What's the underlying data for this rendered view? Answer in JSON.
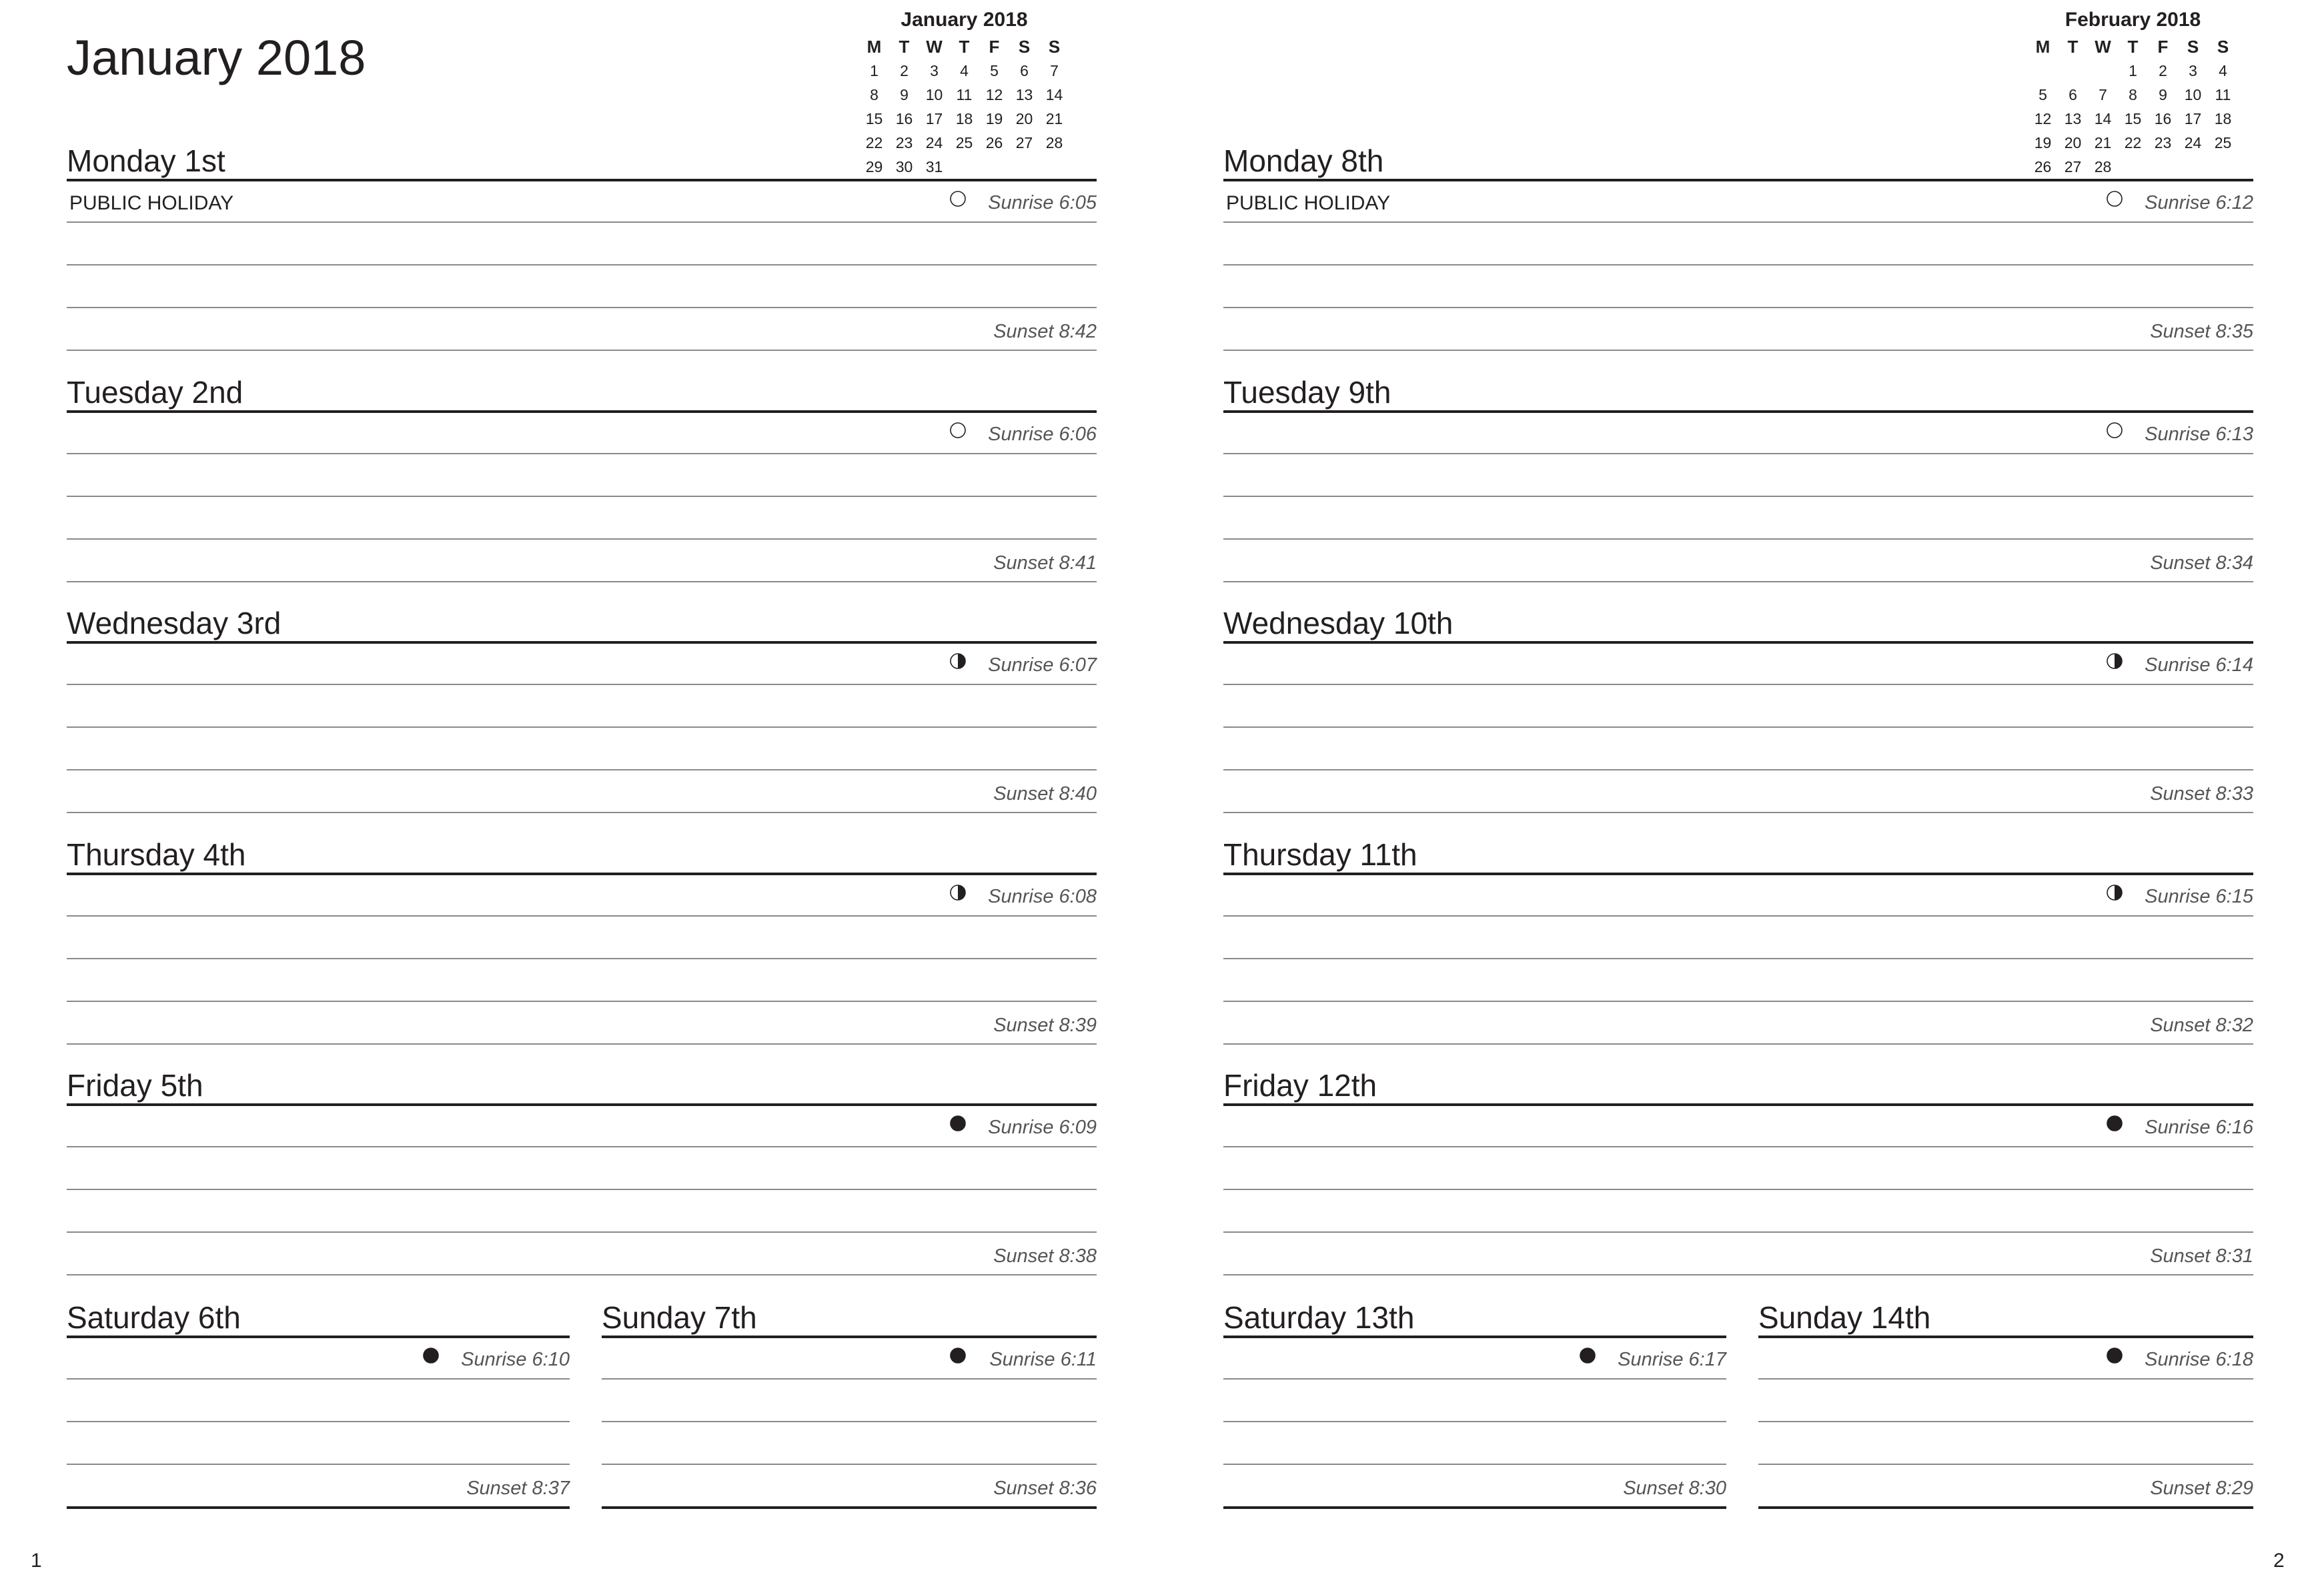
{
  "pages": [
    {
      "title": "January 2018",
      "page_number": "1",
      "mini_calendar": {
        "title": "January 2018",
        "headers": [
          "M",
          "T",
          "W",
          "T",
          "F",
          "S",
          "S"
        ],
        "cells": [
          "1",
          "2",
          "3",
          "4",
          "5",
          "6",
          "7",
          "8",
          "9",
          "10",
          "11",
          "12",
          "13",
          "14",
          "15",
          "16",
          "17",
          "18",
          "19",
          "20",
          "21",
          "22",
          "23",
          "24",
          "25",
          "26",
          "27",
          "28",
          "29",
          "30",
          "31",
          "",
          "",
          "",
          ""
        ]
      },
      "days": [
        {
          "name": "Monday 1st",
          "note": "PUBLIC HOLIDAY",
          "moon": "full-moon-icon",
          "sunrise": "Sunrise 6:05",
          "sunset": "Sunset 8:42"
        },
        {
          "name": "Tuesday 2nd",
          "note": "",
          "moon": "full-moon-icon",
          "sunrise": "Sunrise 6:06",
          "sunset": "Sunset 8:41"
        },
        {
          "name": "Wednesday 3rd",
          "note": "",
          "moon": "waning-gibbous-moon-icon",
          "sunrise": "Sunrise 6:07",
          "sunset": "Sunset 8:40"
        },
        {
          "name": "Thursday 4th",
          "note": "",
          "moon": "waning-gibbous-moon-icon",
          "sunrise": "Sunrise 6:08",
          "sunset": "Sunset 8:39"
        },
        {
          "name": "Friday 5th",
          "note": "",
          "moon": "new-moon-icon",
          "sunrise": "Sunrise 6:09",
          "sunset": "Sunset 8:38"
        },
        {
          "name": "Saturday 6th",
          "note": "",
          "moon": "new-moon-icon",
          "sunrise": "Sunrise 6:10",
          "sunset": "Sunset 8:37"
        },
        {
          "name": "Sunday 7th",
          "note": "",
          "moon": "new-moon-icon",
          "sunrise": "Sunrise 6:11",
          "sunset": "Sunset 8:36"
        }
      ]
    },
    {
      "title": "",
      "page_number": "2",
      "mini_calendar": {
        "title": "February 2018",
        "headers": [
          "M",
          "T",
          "W",
          "T",
          "F",
          "S",
          "S"
        ],
        "cells": [
          "",
          "",
          "",
          "1",
          "2",
          "3",
          "4",
          "5",
          "6",
          "7",
          "8",
          "9",
          "10",
          "11",
          "12",
          "13",
          "14",
          "15",
          "16",
          "17",
          "18",
          "19",
          "20",
          "21",
          "22",
          "23",
          "24",
          "25",
          "26",
          "27",
          "28",
          "",
          "",
          "",
          ""
        ]
      },
      "days": [
        {
          "name": "Monday 8th",
          "note": "PUBLIC HOLIDAY",
          "moon": "full-moon-icon",
          "sunrise": "Sunrise 6:12",
          "sunset": "Sunset 8:35"
        },
        {
          "name": "Tuesday 9th",
          "note": "",
          "moon": "full-moon-icon",
          "sunrise": "Sunrise 6:13",
          "sunset": "Sunset 8:34"
        },
        {
          "name": "Wednesday 10th",
          "note": "",
          "moon": "waning-gibbous-moon-icon",
          "sunrise": "Sunrise 6:14",
          "sunset": "Sunset 8:33"
        },
        {
          "name": "Thursday 11th",
          "note": "",
          "moon": "waning-gibbous-moon-icon",
          "sunrise": "Sunrise 6:15",
          "sunset": "Sunset 8:32"
        },
        {
          "name": "Friday 12th",
          "note": "",
          "moon": "new-moon-icon",
          "sunrise": "Sunrise 6:16",
          "sunset": "Sunset 8:31"
        },
        {
          "name": "Saturday 13th",
          "note": "",
          "moon": "new-moon-icon",
          "sunrise": "Sunrise 6:17",
          "sunset": "Sunset 8:30"
        },
        {
          "name": "Sunday 14th",
          "note": "",
          "moon": "new-moon-icon",
          "sunrise": "Sunrise 6:18",
          "sunset": "Sunset 8:29"
        }
      ]
    }
  ]
}
